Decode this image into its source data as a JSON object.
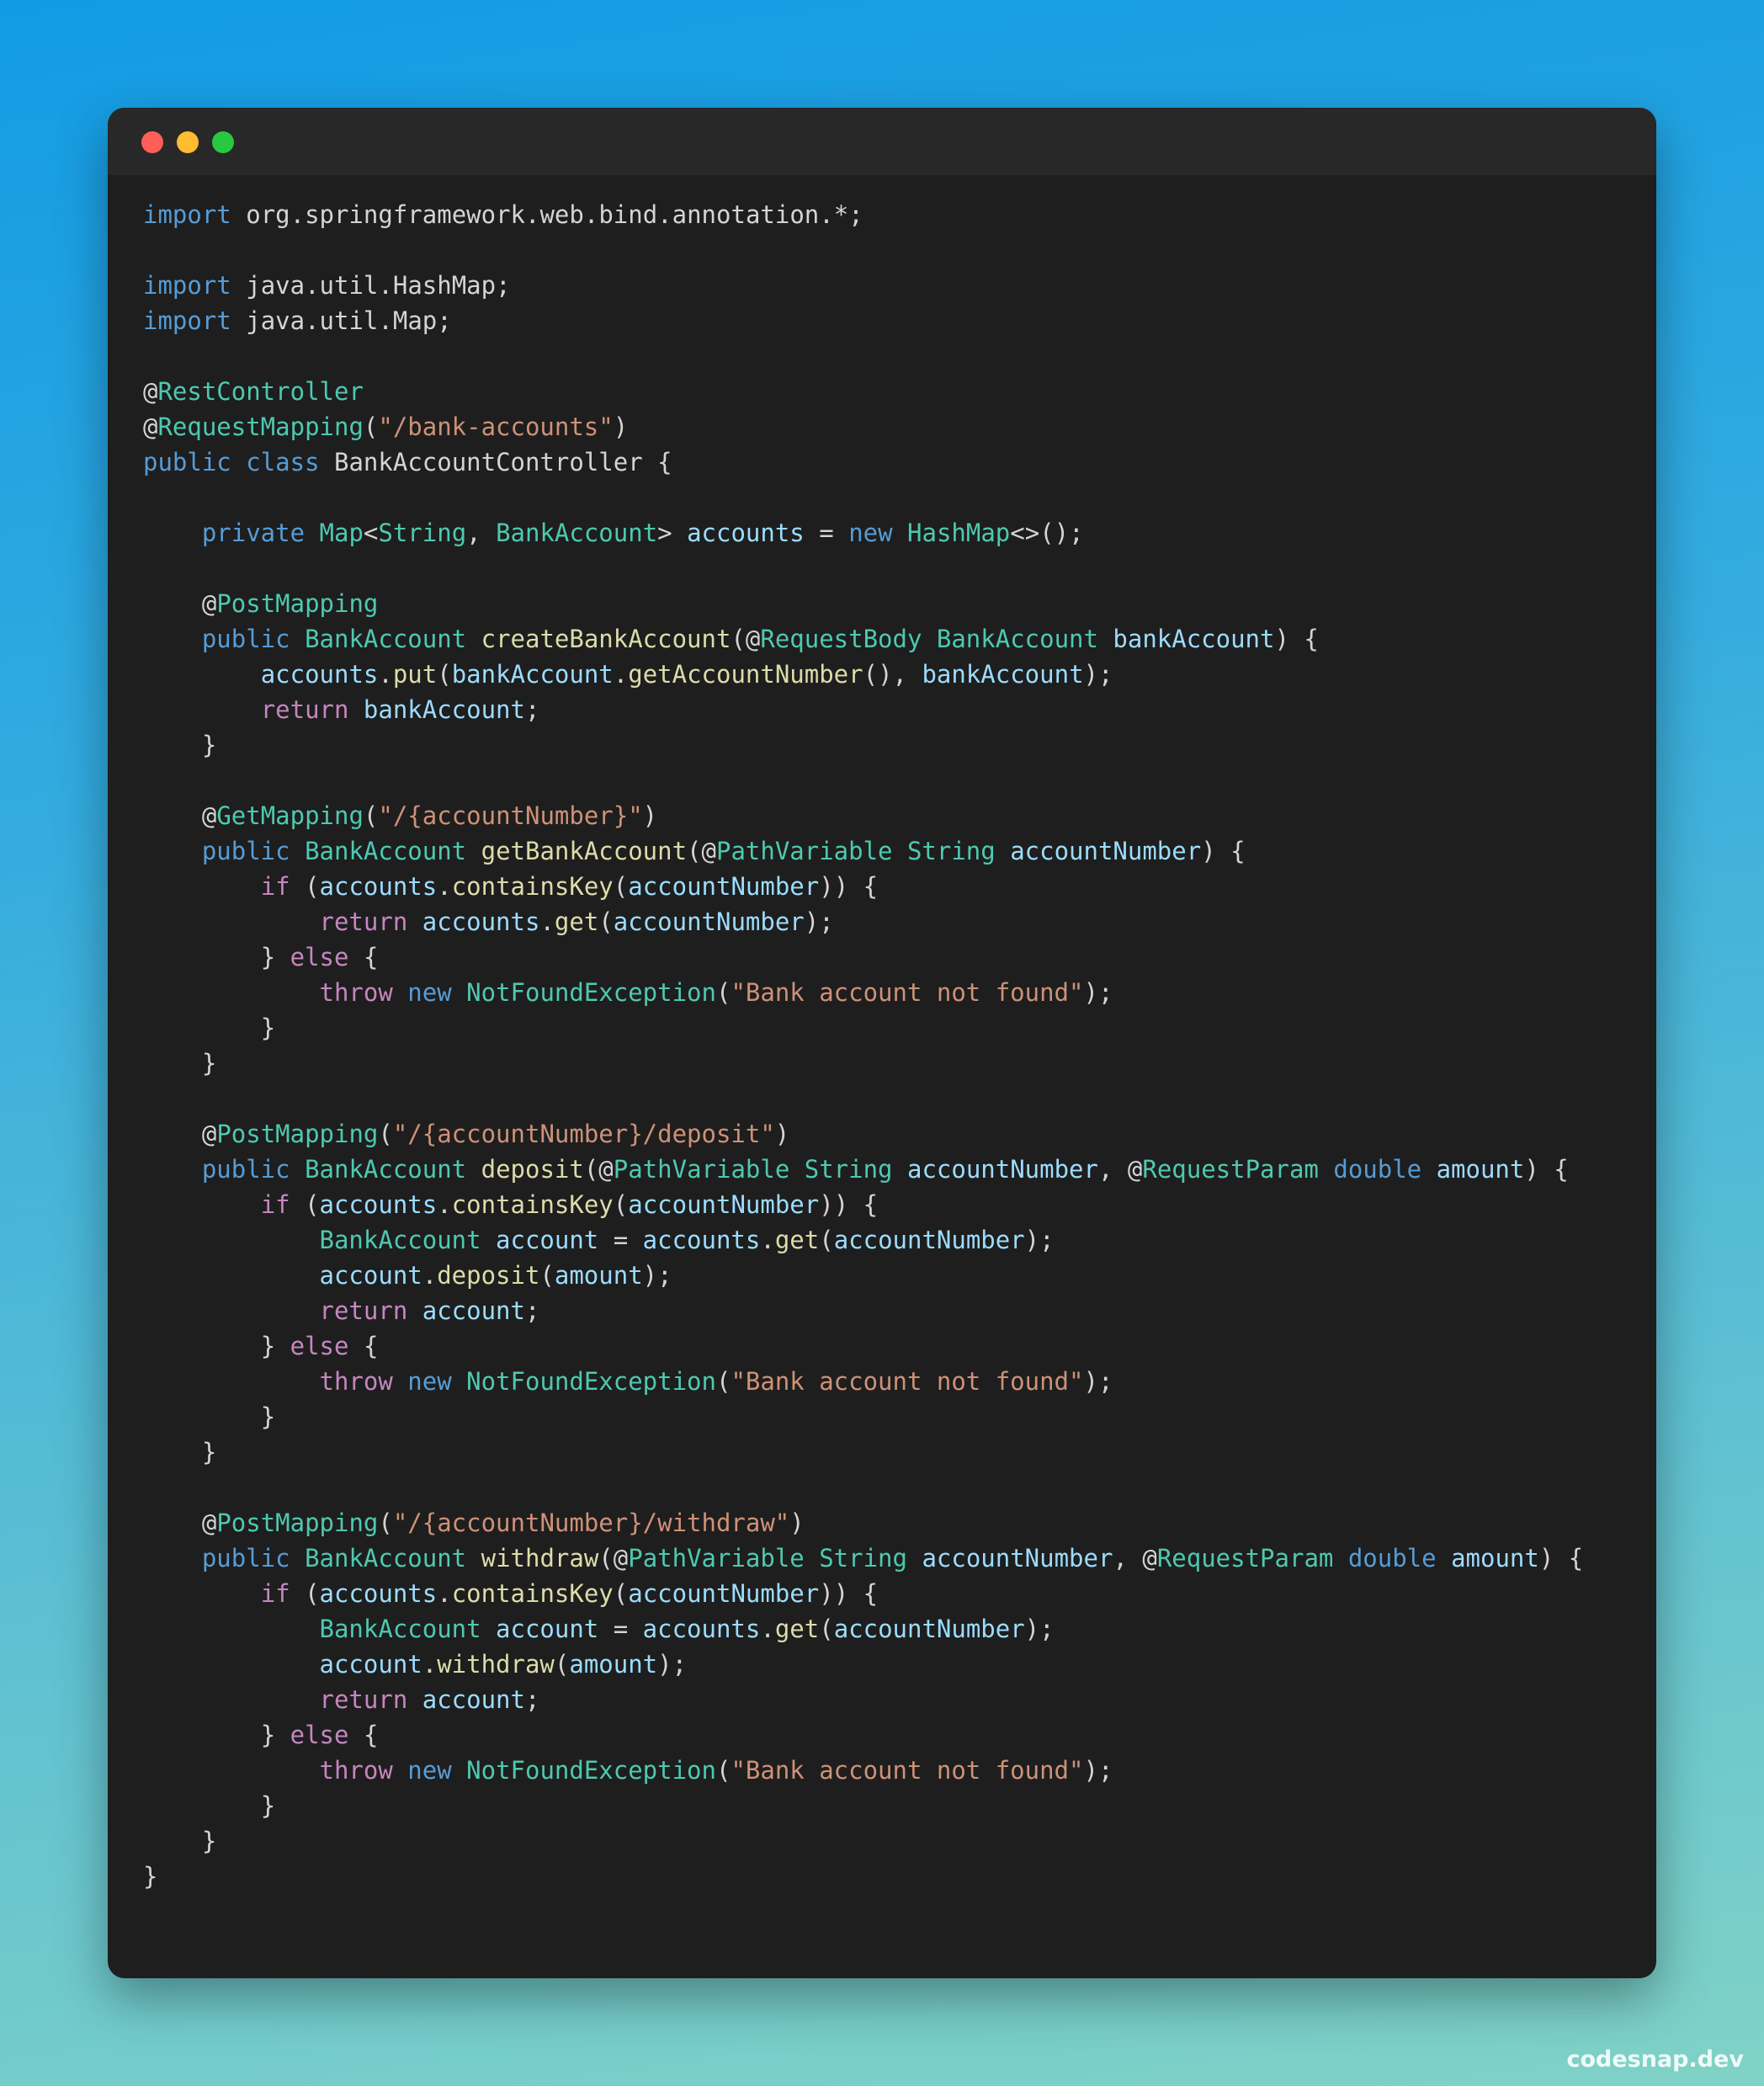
{
  "window": {
    "controls": [
      "close",
      "minimize",
      "maximize"
    ]
  },
  "footer": {
    "watermark": "codesnap.dev"
  },
  "code": {
    "language": "java",
    "lines": [
      "import org.springframework.web.bind.annotation.*;",
      "",
      "import java.util.HashMap;",
      "import java.util.Map;",
      "",
      "@RestController",
      "@RequestMapping(\"/bank-accounts\")",
      "public class BankAccountController {",
      "",
      "    private Map<String, BankAccount> accounts = new HashMap<>();",
      "",
      "    @PostMapping",
      "    public BankAccount createBankAccount(@RequestBody BankAccount bankAccount) {",
      "        accounts.put(bankAccount.getAccountNumber(), bankAccount);",
      "        return bankAccount;",
      "    }",
      "",
      "    @GetMapping(\"/{accountNumber}\")",
      "    public BankAccount getBankAccount(@PathVariable String accountNumber) {",
      "        if (accounts.containsKey(accountNumber)) {",
      "            return accounts.get(accountNumber);",
      "        } else {",
      "            throw new NotFoundException(\"Bank account not found\");",
      "        }",
      "    }",
      "",
      "    @PostMapping(\"/{accountNumber}/deposit\")",
      "    public BankAccount deposit(@PathVariable String accountNumber, @RequestParam double amount) {",
      "        if (accounts.containsKey(accountNumber)) {",
      "            BankAccount account = accounts.get(accountNumber);",
      "            account.deposit(amount);",
      "            return account;",
      "        } else {",
      "            throw new NotFoundException(\"Bank account not found\");",
      "        }",
      "    }",
      "",
      "    @PostMapping(\"/{accountNumber}/withdraw\")",
      "    public BankAccount withdraw(@PathVariable String accountNumber, @RequestParam double amount) {",
      "        if (accounts.containsKey(accountNumber)) {",
      "            BankAccount account = accounts.get(accountNumber);",
      "            account.withdraw(amount);",
      "            return account;",
      "        } else {",
      "            throw new NotFoundException(\"Bank account not found\");",
      "        }",
      "    }",
      "}"
    ]
  },
  "colors": {
    "keyword_blue": "#569cd6",
    "control_purple": "#c586c0",
    "type_teal": "#4ec9b0",
    "function_yellow": "#dcdcaa",
    "string_orange": "#ce9178",
    "variable_lightblue": "#9cdcfe",
    "text": "#d4d4d4",
    "editor_background": "#1e1e1e",
    "titlebar_background": "#282828"
  }
}
